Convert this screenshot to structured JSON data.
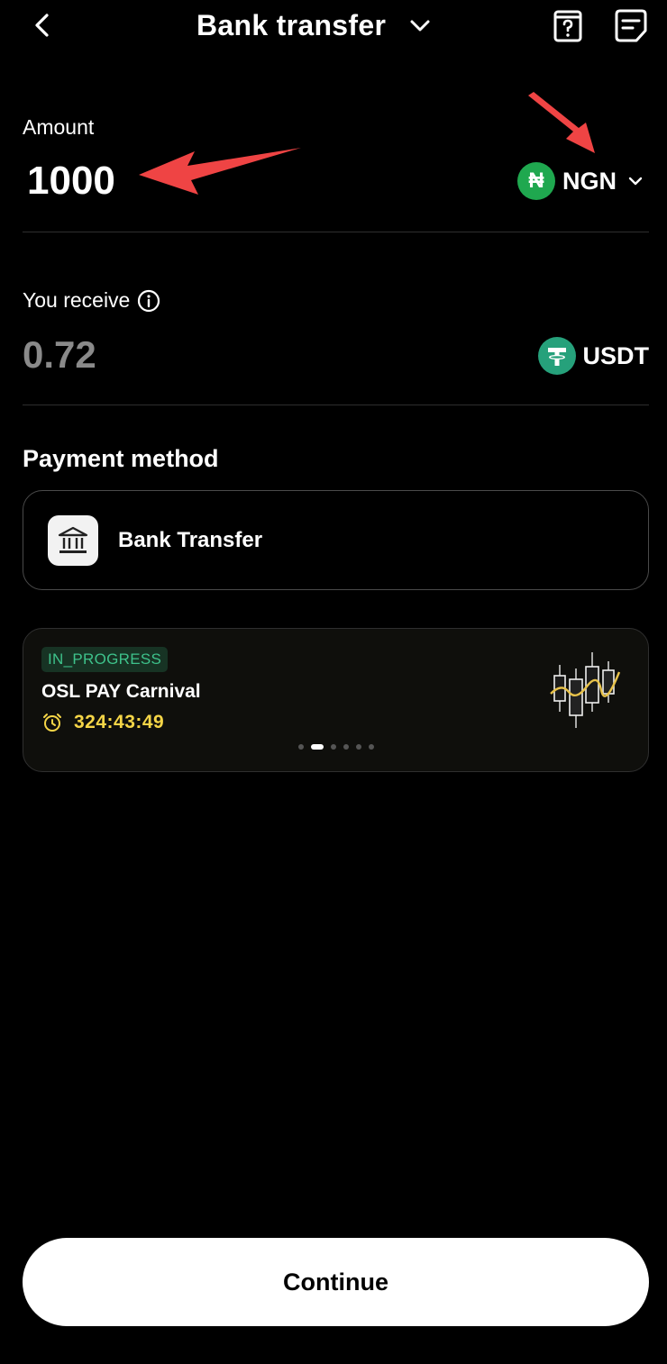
{
  "header": {
    "title": "Bank transfer",
    "back_icon": "chevron-left-icon",
    "title_dropdown_icon": "chevron-down-icon",
    "help_icon": "help-document-icon",
    "orders_icon": "orders-list-icon"
  },
  "amount": {
    "label": "Amount",
    "value": "1000",
    "currency": {
      "symbol": "₦",
      "code": "NGN",
      "icon_color": "#1fa84f"
    }
  },
  "receive": {
    "label": "You receive",
    "value": "0.72",
    "currency": {
      "symbol": "₮",
      "code": "USDT",
      "icon_color": "#26a17b"
    }
  },
  "payment": {
    "section_title": "Payment method",
    "method_label": "Bank Transfer",
    "method_icon": "bank-icon"
  },
  "promo": {
    "badge": "IN_PROGRESS",
    "title": "OSL PAY Carnival",
    "timer": "324:43:49",
    "timer_color": "#f5d547",
    "slides_count": 6,
    "active_slide": 2
  },
  "continue_label": "Continue",
  "annotation_color": "#ef4444"
}
